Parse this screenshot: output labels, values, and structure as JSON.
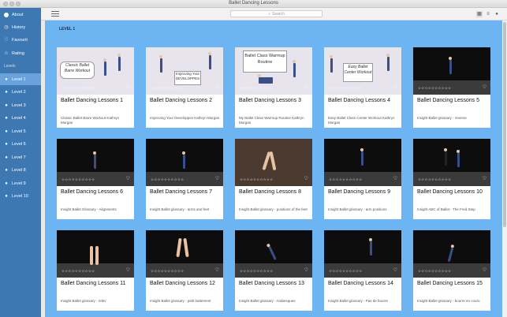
{
  "window": {
    "title": "Ballet Dancing Lessons"
  },
  "sidebar": {
    "top_items": [
      {
        "label": "About",
        "icon": "info-icon"
      },
      {
        "label": "History",
        "icon": "history-icon"
      },
      {
        "label": "Favourit",
        "icon": "heart-icon"
      },
      {
        "label": "Rating",
        "icon": "star-icon"
      }
    ],
    "section_label": "Levels",
    "levels": [
      {
        "label": "Level 1",
        "active": true
      },
      {
        "label": "Level 2"
      },
      {
        "label": "Level 3"
      },
      {
        "label": "Level 4"
      },
      {
        "label": "Level 5"
      },
      {
        "label": "Level 6"
      },
      {
        "label": "Level 7"
      },
      {
        "label": "Level 8"
      },
      {
        "label": "Level 9"
      },
      {
        "label": "Level 10"
      }
    ]
  },
  "toolbar": {
    "search_placeholder": "Search"
  },
  "main": {
    "heading": "LEVEL 1",
    "cards": [
      {
        "title": "Ballet Dancing Lessons 1",
        "subtitle": "Classic Ballet Barre Workout   Kathryn Morgan",
        "thumb_caption": "Classic Ballet Barre Workout"
      },
      {
        "title": "Ballet Dancing Lessons 2",
        "subtitle": "Improving Your Developpes   Kathryn Morgan",
        "thumb_caption": "Improving Your DEVELOPPES"
      },
      {
        "title": "Ballet Dancing Lessons 3",
        "subtitle": "My Ballet Class Warmup Routine   Kathryn Morgan",
        "thumb_caption": "Ballet Class Warmup Routine"
      },
      {
        "title": "Ballet Dancing Lessons 4",
        "subtitle": "Easy Ballet Class Center Workout   Kathryn Morgan",
        "thumb_caption": "Easy Ballet Center Workout"
      },
      {
        "title": "Ballet Dancing Lessons 5",
        "subtitle": "Insight Ballet glossary - reverse"
      },
      {
        "title": "Ballet Dancing Lessons 6",
        "subtitle": "Insight Ballet Glossary - Alignments"
      },
      {
        "title": "Ballet Dancing Lessons 7",
        "subtitle": "Insight Ballet glossary - arms and feet"
      },
      {
        "title": "Ballet Dancing Lessons 8",
        "subtitle": "Insight Ballet glossary - positions of the feet"
      },
      {
        "title": "Ballet Dancing Lessons 9",
        "subtitle": "Insight Ballet glossary - arm positions"
      },
      {
        "title": "Ballet Dancing Lessons 10",
        "subtitle": "Insight ABC of Ballet - The Fred Step"
      },
      {
        "title": "Ballet Dancing Lessons 11",
        "subtitle": "Insight Ballet glossary - relev"
      },
      {
        "title": "Ballet Dancing Lessons 12",
        "subtitle": "Insight Ballet glossary - petit battement"
      },
      {
        "title": "Ballet Dancing Lessons 13",
        "subtitle": "Insight Ballet glossary - Arabesques"
      },
      {
        "title": "Ballet Dancing Lessons 14",
        "subtitle": "Insight Ballet glossary - Pas de bourre"
      },
      {
        "title": "Ballet Dancing Lessons 15",
        "subtitle": "Insight Ballet glossary - bourre en couru"
      }
    ],
    "stars_text": "☆☆☆☆☆☆☆☆☆☆"
  },
  "colors": {
    "sidebar": "#3e78b3",
    "sidebar_active": "#6aa2dc",
    "main_bg": "#6db4f2"
  }
}
